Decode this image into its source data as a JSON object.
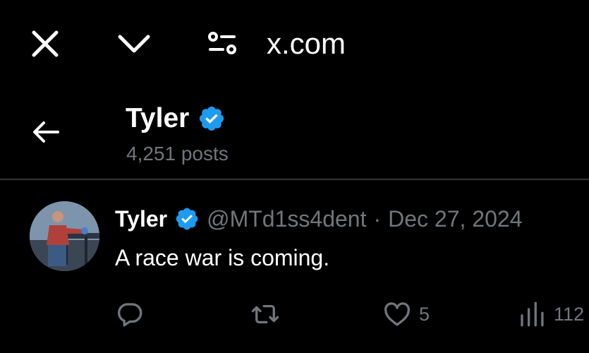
{
  "browser": {
    "url": "x.com",
    "close_icon": "close-icon",
    "chevron_icon": "chevron-down-icon",
    "site_settings_icon": "tune-icon"
  },
  "profile_header": {
    "back_icon": "back-arrow-icon",
    "name": "Tyler",
    "verified": true,
    "posts_count": "4,251 posts"
  },
  "tweet": {
    "author_name": "Tyler",
    "verified": true,
    "handle": "@MTd1ss4dent",
    "separator": "·",
    "date": "Dec 27, 2024",
    "text": "A race war is coming.",
    "actions": {
      "reply_count": "",
      "retweet_count": "",
      "like_count": "5",
      "view_count": "112"
    }
  },
  "colors": {
    "background": "#000000",
    "verified_blue": "#1d9bf0",
    "muted_text": "#71767b",
    "divider": "#2f3336"
  }
}
